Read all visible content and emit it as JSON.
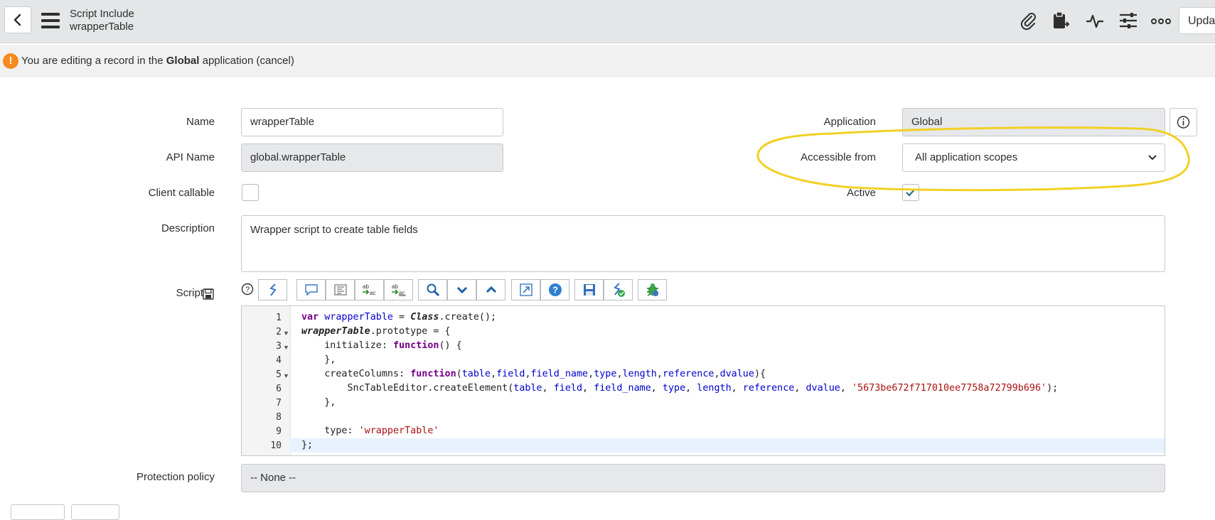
{
  "header": {
    "record_type": "Script Include",
    "record_name": "wrapperTable",
    "update_label": "Update",
    "icons": [
      "back-icon",
      "menu-icon",
      "paperclip-icon",
      "clipboard-icon",
      "activity-icon",
      "sliders-icon",
      "more-icon"
    ]
  },
  "banner": {
    "prefix": "You are editing a record in the ",
    "app": "Global",
    "suffix": " application ",
    "cancel": "(cancel)"
  },
  "form": {
    "name_label": "Name",
    "name_value": "wrapperTable",
    "api_label": "API Name",
    "api_value": "global.wrapperTable",
    "client_label": "Client callable",
    "client_checked": false,
    "description_label": "Description",
    "description_value": "Wrapper script to create table fields",
    "script_label": "Script",
    "protection_label": "Protection policy",
    "protection_value": "-- None --",
    "application_label": "Application",
    "application_value": "Global",
    "accessible_label": "Accessible from",
    "accessible_value": "All application scopes",
    "active_label": "Active",
    "active_checked": true
  },
  "editor": {
    "line_numbers": [
      "1",
      "2",
      "3",
      "4",
      "5",
      "6",
      "7",
      "8",
      "9",
      "10"
    ],
    "highlight_color": "#f2d024"
  },
  "colors": {
    "header_bg": "#e4e6e7",
    "warning": "#f58a1f",
    "keyword": "#770088",
    "variable": "#0000cc",
    "string": "#aa1111"
  }
}
